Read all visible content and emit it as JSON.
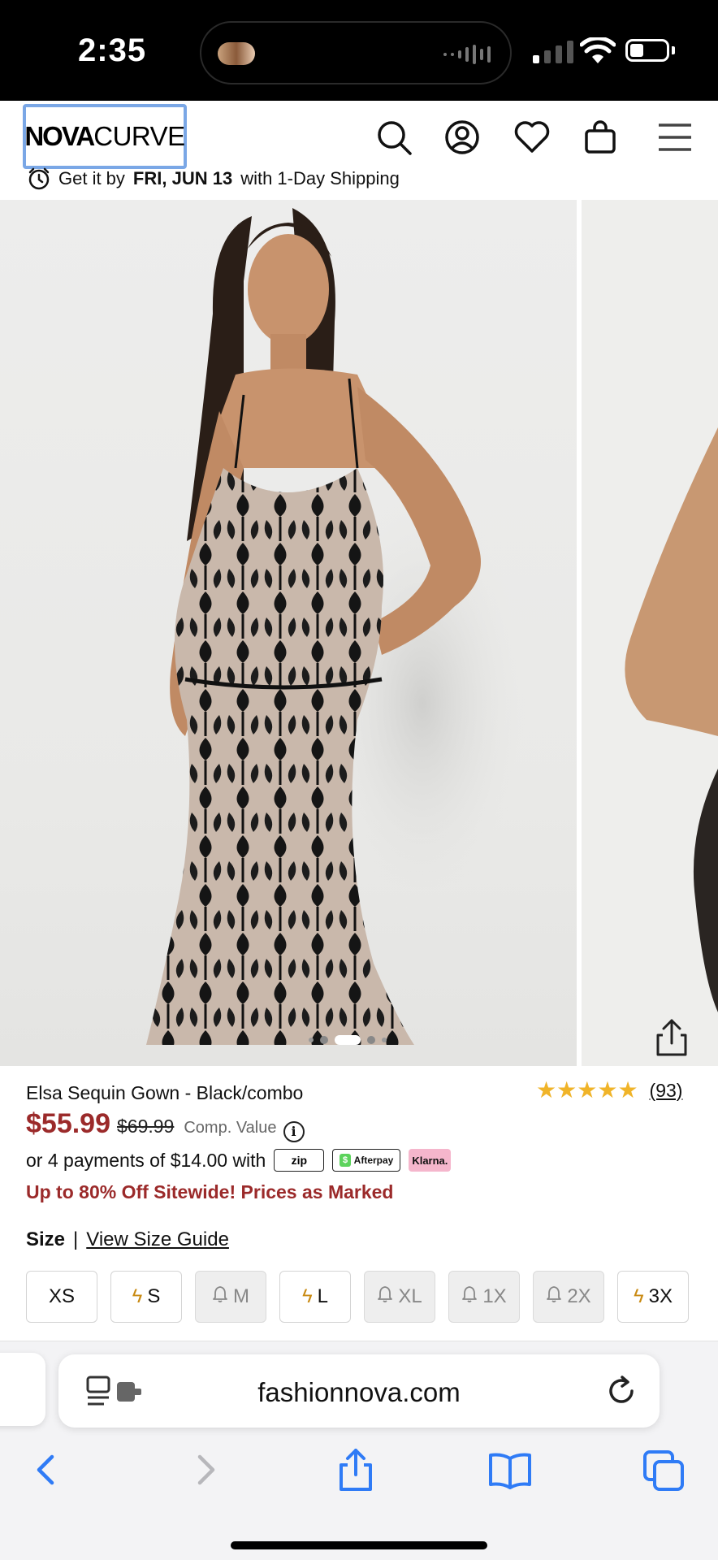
{
  "status_bar": {
    "time": "2:35"
  },
  "header": {
    "logo_part1": "NOVA",
    "logo_part2": "CURVE",
    "icons": [
      "search-icon",
      "account-icon",
      "wishlist-heart-icon",
      "shopping-bag-icon",
      "hamburger-menu-icon"
    ],
    "shipping_prefix": "Get it by",
    "shipping_date": "FRI, JUN 13",
    "shipping_suffix": "with 1-Day Shipping"
  },
  "gallery": {
    "slide_count": 5,
    "active_slide": 2
  },
  "product": {
    "title": "Elsa Sequin Gown - Black/combo",
    "rating_stars": 5,
    "review_count": "(93)",
    "price_sale": "$55.99",
    "price_original": "$69.99",
    "comp_value_label": "Comp. Value",
    "installments_text": "or 4 payments of $14.00 with",
    "payment_badges": {
      "zip": "zip",
      "afterpay": "Afterpay",
      "klarna": "Klarna."
    },
    "promo": "Up to 80% Off Sitewide! Prices as Marked",
    "size_label": "Size",
    "size_separator": "|",
    "size_guide": "View Size Guide",
    "sizes": [
      {
        "label": "XS",
        "state": "available"
      },
      {
        "label": "S",
        "state": "low-stock"
      },
      {
        "label": "M",
        "state": "out-of-stock"
      },
      {
        "label": "L",
        "state": "low-stock"
      },
      {
        "label": "XL",
        "state": "out-of-stock"
      },
      {
        "label": "1X",
        "state": "out-of-stock"
      },
      {
        "label": "2X",
        "state": "out-of-stock"
      },
      {
        "label": "3X",
        "state": "low-stock"
      }
    ]
  },
  "browser": {
    "url": "fashionnova.com"
  },
  "colors": {
    "sale_red": "#9b2a2a",
    "star_gold": "#f0b429",
    "safari_blue": "#2f7bf6",
    "logo_highlight": "#7aa7e6"
  }
}
